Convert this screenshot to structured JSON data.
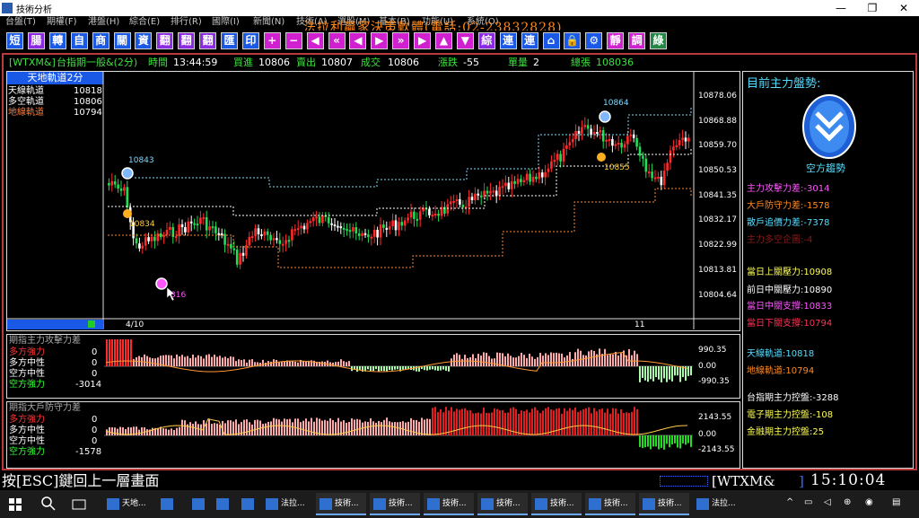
{
  "window": {
    "title": "技術分析",
    "controls": [
      "—",
      "❐",
      "✕"
    ]
  },
  "banner": "法拉利贏家決策軟體(電話:02-23832828)",
  "menu": [
    "台盤(T)",
    "期權(F)",
    "港盤(H)",
    "綜合(E)",
    "排行(R)",
    "國際(I)",
    "新聞(N)",
    "技術(A)",
    "選股(M)",
    "基本(B)",
    "功能(U)",
    "系統(O)"
  ],
  "toolbar": [
    "短",
    "腸",
    "轉",
    "自",
    "商",
    "關",
    "資",
    "翻",
    "翻",
    "翻",
    "匯",
    "印",
    "+",
    "−",
    "◀",
    "«",
    "◀",
    "▶",
    "»",
    "▶",
    "▲",
    "▼",
    "綜",
    "連",
    "連",
    "⌂",
    "🔒",
    "⚙",
    "靜",
    "調",
    "綠"
  ],
  "info": {
    "symbol": "[WTXM&]",
    "name": "台指期一般&(2分)",
    "time_label": "時間",
    "time": "13:44:59",
    "bid_label": "買進",
    "bid": "10806",
    "ask_label": "賣出",
    "ask": "10807",
    "last_label": "成交",
    "last": "10806",
    "change_label": "漲跌",
    "change": "-55",
    "vol_label": "單量",
    "vol": "2",
    "total_label": "總張",
    "total": "108036"
  },
  "main_panel": {
    "title": "天地軌道2分",
    "legend": [
      {
        "name": "天線軌道",
        "value": "10818",
        "color": "#ffffff"
      },
      {
        "name": "多空軌道",
        "value": "10806",
        "color": "#ffffff"
      },
      {
        "name": "地線軌道",
        "value": "10794",
        "color": "#ff7a3a"
      }
    ],
    "y_ticks": [
      "10878.06",
      "10868.88",
      "10859.70",
      "10850.53",
      "10841.35",
      "10832.17",
      "10822.99",
      "10813.81",
      "10804.64"
    ],
    "x_ticks": [
      "4/10",
      "11"
    ],
    "annotations": [
      {
        "text": "10843",
        "color": "#7fd8ff"
      },
      {
        "text": "10834",
        "color": "#ffcc33"
      },
      {
        "text": "10864",
        "color": "#7fd8ff"
      },
      {
        "text": "10855",
        "color": "#ffcc33"
      },
      {
        "text": "316",
        "color": "#ff55ff"
      }
    ]
  },
  "panel2": {
    "title": "期指主力攻擊力差",
    "legend": [
      {
        "name": "多方強力",
        "value": "0",
        "color": "#ff3333"
      },
      {
        "name": "多方中性",
        "value": "0",
        "color": "#ffffff"
      },
      {
        "name": "空方中性",
        "value": "0",
        "color": "#ffffff"
      },
      {
        "name": "空方強力",
        "value": "-3014",
        "color": "#33ff33"
      }
    ],
    "y_ticks": [
      "990.35",
      "0.00",
      "-990.35"
    ]
  },
  "panel3": {
    "title": "期指大戶防守力差",
    "legend": [
      {
        "name": "多方強力",
        "value": "0",
        "color": "#ff3333"
      },
      {
        "name": "多方中性",
        "value": "0",
        "color": "#ffffff"
      },
      {
        "name": "空方中性",
        "value": "0",
        "color": "#ffffff"
      },
      {
        "name": "空方強力",
        "value": "-1578",
        "color": "#33ff33"
      }
    ],
    "y_ticks": [
      "2143.55",
      "0.00",
      "-2143.55"
    ]
  },
  "right_panel": {
    "heading": "目前主力盤勢:",
    "trend": "空方趨勢",
    "group1": [
      {
        "text": "主力攻擊力差:-3014",
        "color": "#ff55ff"
      },
      {
        "text": "大戶防守力差:-1578",
        "color": "#ff8a1e"
      },
      {
        "text": "散戶追價力差:-7378",
        "color": "#55ddff"
      },
      {
        "text": "主力多空企圖:-4",
        "color": "#8b1a1a"
      }
    ],
    "group2": [
      {
        "text": "當日上關壓力:10908",
        "color": "#ffff55"
      },
      {
        "text": "前日中關壓力:10890",
        "color": "#ffffff"
      },
      {
        "text": "當日中關支撐:10833",
        "color": "#ff55ff"
      },
      {
        "text": "當日下關支撐:10794",
        "color": "#ff3355"
      }
    ],
    "group3": [
      {
        "text": "天線軌道:10818",
        "color": "#55ddff"
      },
      {
        "text": "地線軌道:10794",
        "color": "#ff8a1e"
      }
    ],
    "group4": [
      {
        "text": "台指期主力控盤:-3288",
        "color": "#ffffff"
      },
      {
        "text": "電子期主力控盤:-108",
        "color": "#ffff55"
      },
      {
        "text": "金融期主力控盤:25",
        "color": "#ffff55"
      }
    ]
  },
  "status": {
    "hint": "按[ESC]鍵回上一層畫面",
    "symbol": "[WTXM&",
    "bracket": "]",
    "clock": "15:10:04"
  },
  "taskbar": {
    "items": [
      "天地...",
      "",
      "",
      "",
      "",
      "法拉...",
      "技術...",
      "技術...",
      "技術...",
      "技術...",
      "技術...",
      "技術...",
      "技術...",
      "法拉..."
    ]
  }
}
